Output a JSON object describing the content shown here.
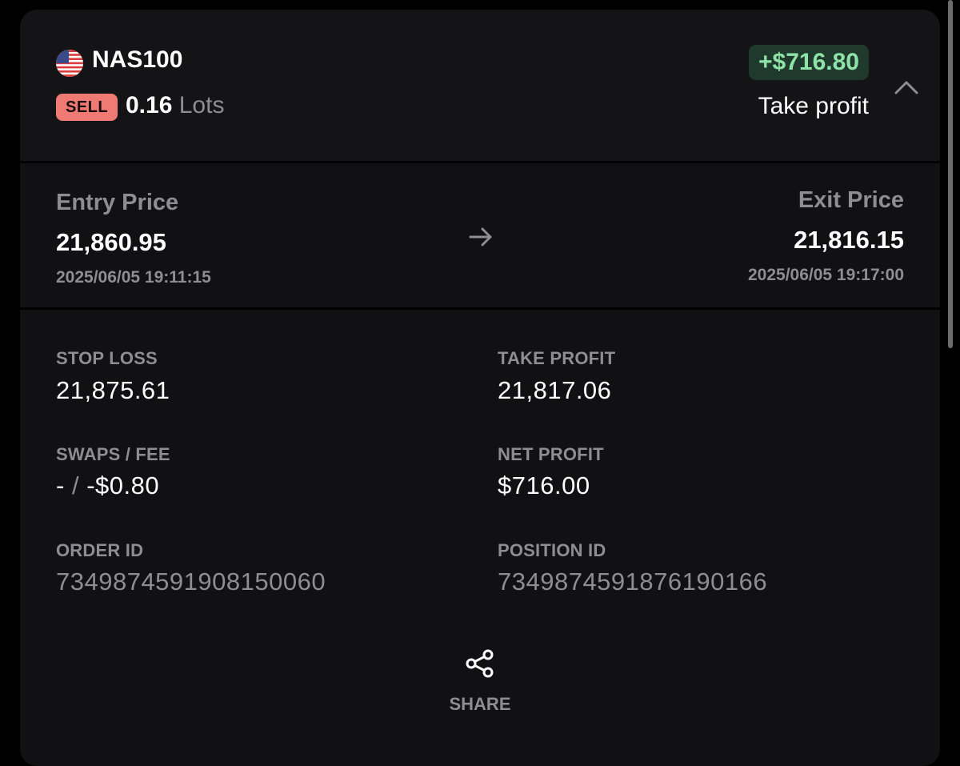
{
  "trade": {
    "symbol": "NAS100",
    "side": "SELL",
    "lots_value": "0.16",
    "lots_unit": "Lots",
    "pnl": "+$716.80",
    "close_reason": "Take profit"
  },
  "prices": {
    "entry_label": "Entry Price",
    "entry_price": "21,860.95",
    "entry_time": "2025/06/05 19:11:15",
    "exit_label": "Exit Price",
    "exit_price": "21,816.15",
    "exit_time": "2025/06/05 19:17:00"
  },
  "details": {
    "stop_loss_label": "STOP LOSS",
    "stop_loss_value": "21,875.61",
    "take_profit_label": "TAKE PROFIT",
    "take_profit_value": "21,817.06",
    "swaps_fee_label": "SWAPS / FEE",
    "swaps_value": "-",
    "swaps_sep": "/",
    "fee_value": "-$0.80",
    "net_profit_label": "NET PROFIT",
    "net_profit_value": "$716.00",
    "order_id_label": "ORDER ID",
    "order_id_value": "7349874591908150060",
    "position_id_label": "POSITION ID",
    "position_id_value": "7349874591876190166"
  },
  "actions": {
    "share_label": "SHARE"
  },
  "icons": {
    "flag": "us-flag-icon",
    "collapse": "chevron-up-icon",
    "arrow": "arrow-right-icon",
    "share": "share-icon"
  },
  "colors": {
    "sell_badge": "#ee7a73",
    "profit_badge_bg": "#1f3a2c",
    "profit_text": "#8fe3a8",
    "muted_text": "#8d8d93"
  }
}
